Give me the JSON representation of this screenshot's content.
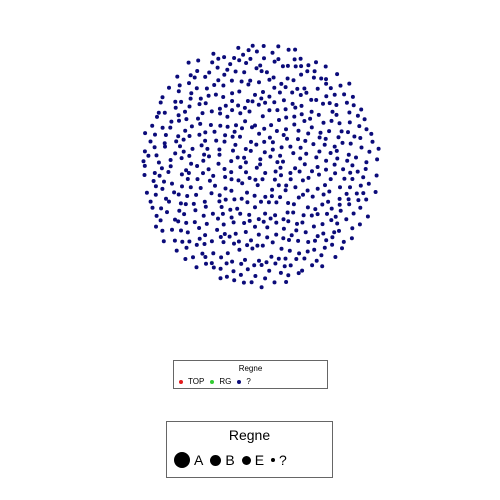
{
  "chart_data": {
    "type": "scatter",
    "title": "",
    "xlabel": "",
    "ylabel": "",
    "grid": false,
    "point_color": "#0b0b7a",
    "series": [
      {
        "name": "?",
        "color": "#0b0b7a",
        "point_count": 600
      }
    ],
    "legends": [
      {
        "title": "Regne",
        "kind": "color",
        "placement": "bottom-center",
        "entries": [
          {
            "label": "TOP",
            "color": "#e31a1c"
          },
          {
            "label": "RG",
            "color": "#33cc33"
          },
          {
            "label": "?",
            "color": "#0b0b7a"
          }
        ]
      },
      {
        "title": "Regne",
        "kind": "size",
        "placement": "bottom-center",
        "entries": [
          {
            "label": "A",
            "relative_size": 4
          },
          {
            "label": "B",
            "relative_size": 3
          },
          {
            "label": "E",
            "relative_size": 2.5
          },
          {
            "label": "?",
            "relative_size": 1
          }
        ]
      }
    ]
  }
}
